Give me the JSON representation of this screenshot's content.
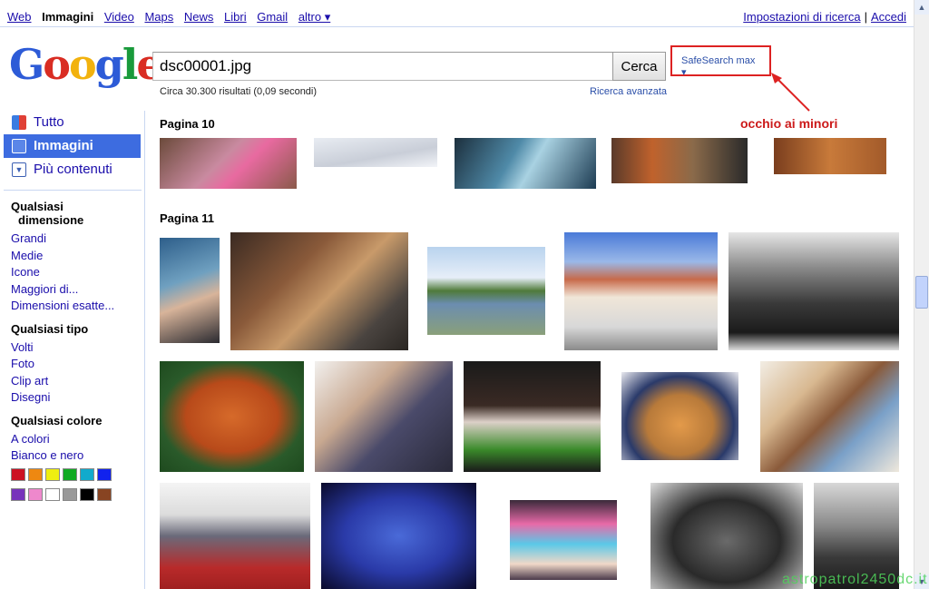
{
  "topnav": {
    "links": [
      "Web",
      "Immagini",
      "Video",
      "Maps",
      "News",
      "Libri",
      "Gmail",
      "altro ▾"
    ],
    "settings": "Impostazioni di ricerca",
    "separator": "|",
    "login": "Accedi"
  },
  "logo": {
    "letters": [
      "G",
      "o",
      "o",
      "g",
      "l",
      "e"
    ],
    "colors": [
      "#2d5bd7",
      "#d92d23",
      "#f2b20e",
      "#2d5bd7",
      "#199a3b",
      "#d92d23"
    ]
  },
  "search": {
    "query": "dsc00001.jpg",
    "button": "Cerca",
    "safesearch": "SafeSearch max ▾",
    "stats": "Circa 30.300 risultati (0,09 secondi)",
    "advanced": "Ricerca avanzata"
  },
  "annotation": "occhio ai minori",
  "sidebar": {
    "nav": [
      {
        "label": "Tutto",
        "icon": "google-icon"
      },
      {
        "label": "Immagini",
        "icon": "camera-icon"
      },
      {
        "label": "Più contenuti",
        "icon": "chevron-down-icon"
      }
    ],
    "size": {
      "title_line1": "Qualsiasi",
      "title_line2": "dimensione",
      "options": [
        "Grandi",
        "Medie",
        "Icone",
        "Maggiori di...",
        "Dimensioni esatte..."
      ]
    },
    "type": {
      "title": "Qualsiasi tipo",
      "options": [
        "Volti",
        "Foto",
        "Clip art",
        "Disegni"
      ]
    },
    "color": {
      "title": "Qualsiasi colore",
      "options": [
        "A colori",
        "Bianco e nero"
      ],
      "swatches": [
        "#cc1122",
        "#ee8811",
        "#eeee11",
        "#11aa22",
        "#11aacc",
        "#1122ee",
        "#7733bb",
        "#ee88cc",
        "#ffffff",
        "#999999",
        "#000000",
        "#884422"
      ]
    }
  },
  "results": {
    "page10": "Pagina 10",
    "page11": "Pagina 11"
  },
  "watermark": "astropatrol2450dc.it"
}
